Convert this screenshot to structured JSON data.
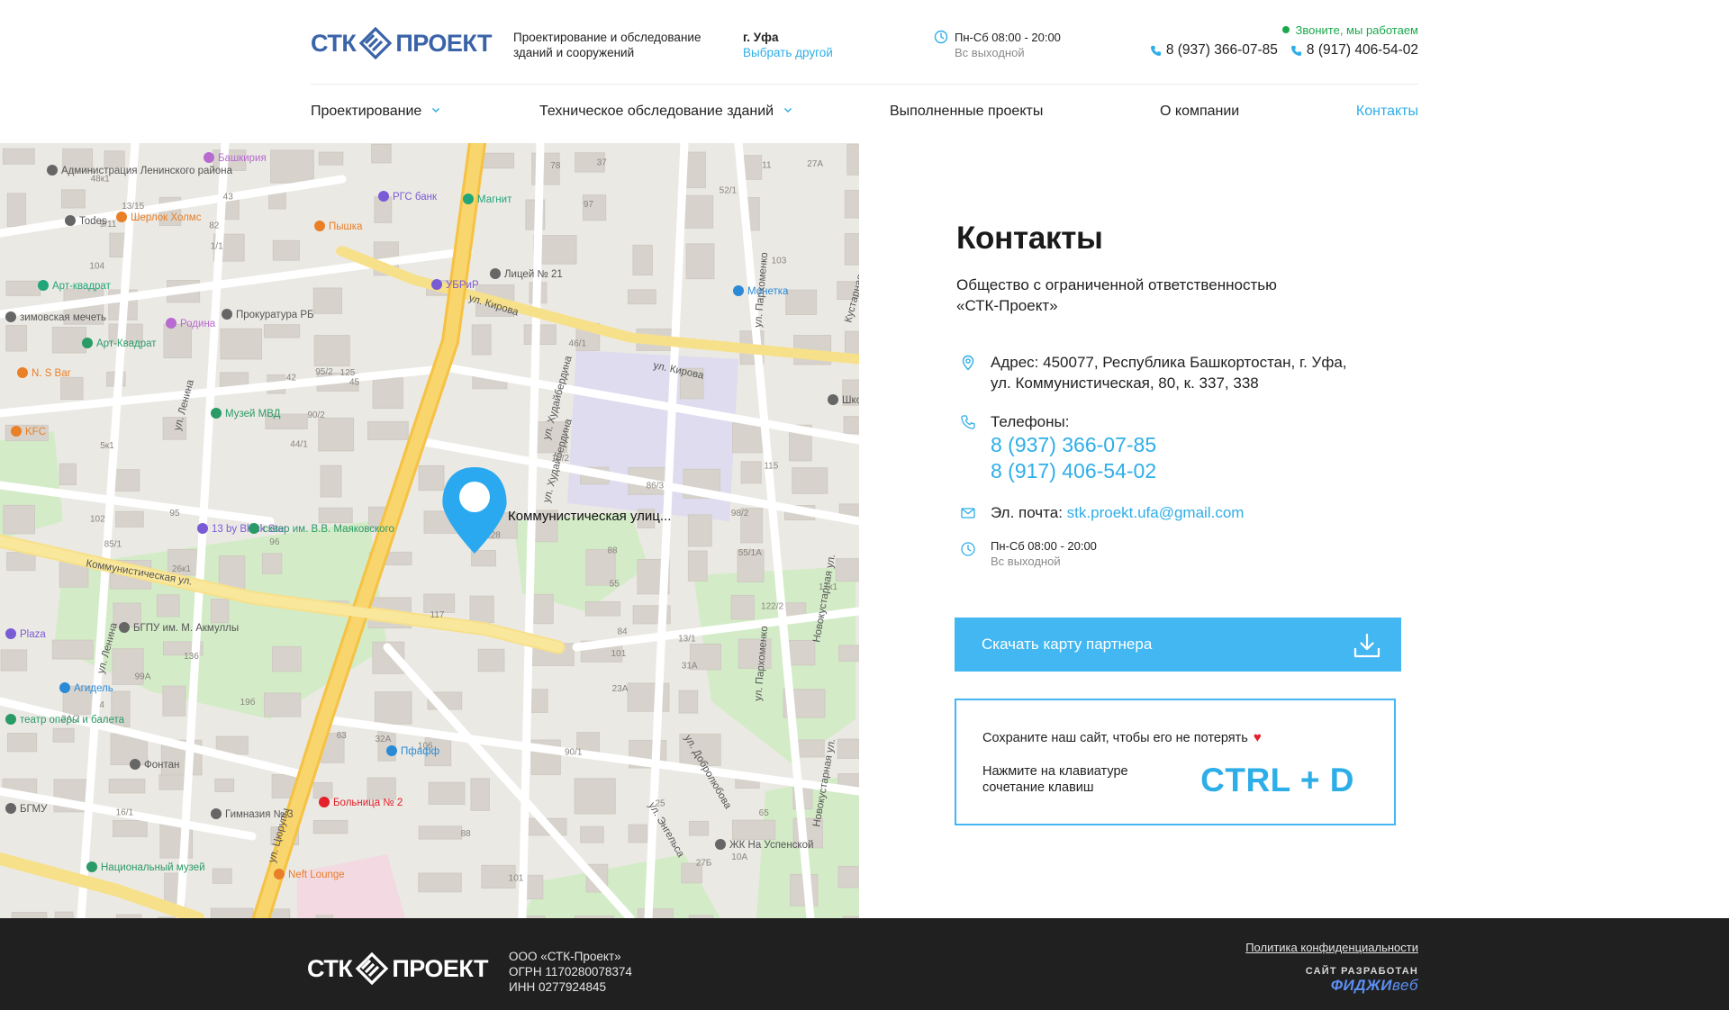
{
  "header": {
    "logo_left": "СТК",
    "logo_right": "ПРОЕКТ",
    "tagline_line1": "Проектирование и обследование",
    "tagline_line2": "зданий и сооружений",
    "city_label": "г. Уфа",
    "city_change": "Выбрать другой",
    "hours": "Пн-Сб 08:00 - 20:00",
    "hours_sub": "Вс выходной",
    "call_status": "Звоните, мы работаем",
    "phone1": "8 (937) 366-07-85",
    "phone2": "8 (917) 406-54-02",
    "accent_color": "#2eaee8"
  },
  "nav": {
    "items": [
      {
        "label": "Проектирование",
        "has_dropdown": true
      },
      {
        "label": "Техническое обследование зданий",
        "has_dropdown": true
      },
      {
        "label": "Выполненные проекты",
        "has_dropdown": false
      },
      {
        "label": "О компании",
        "has_dropdown": false
      },
      {
        "label": "Контакты",
        "has_dropdown": false,
        "active": true
      }
    ]
  },
  "map": {
    "marker_label": "Коммунистическая улиц...",
    "streets": [
      "ул. Кирова",
      "ул. Кирова",
      "Коммунистическая ул.",
      "ул. Ленина",
      "ул. Ленина",
      "ул. Ленина",
      "ул. Цюрупы",
      "ул. Худайбердина",
      "ул. Худайбердина",
      "ул. Пархоменко",
      "ул. Пархоменко",
      "ул. Добролюбова",
      "ул. Энгельса",
      "Коммунистическая ул.",
      "Новокустарная ул.",
      "Новокустарная ул.",
      "Кустарная ул."
    ],
    "places": [
      "Башкирия",
      "Администрация Ленинского района",
      "Todes",
      "Шерлок Холмс",
      "Пышка",
      "РГС банк",
      "Магнит",
      "Монетка",
      "УБРиР",
      "Лицей № 21",
      "Арт-квадрат",
      "Арт-Квадрат",
      "Прокуратура РБ",
      "Родина",
      "N. S Bar",
      "Музей МВД",
      "KFC",
      "Школа №",
      "13 by Black Star",
      "сквер им. В.В. Маяковского",
      "БГПУ им. М. Акмуллы",
      "Агидель",
      "Фонтан",
      "Гимназия № 3",
      "Больница № 2",
      "Пфафф",
      "Национальный музей",
      "Neft Lounge",
      "ЖК На Успенской",
      "БГМУ",
      "зимовская мечеть",
      "театр оперы и балета",
      "Plaza"
    ],
    "house_numbers": [
      "55",
      "55/1A",
      "16/1",
      "43",
      "45",
      "25",
      "4",
      "97",
      "42",
      "101",
      "104",
      "102",
      "9/11",
      "65",
      "63",
      "115",
      "117",
      "128",
      "125",
      "136",
      "27A",
      "52/1",
      "44/1",
      "122/2",
      "78",
      "82",
      "84",
      "85/1",
      "1/1",
      "86/3",
      "88",
      "90/1",
      "90/2",
      "96",
      "98/2",
      "31A",
      "101",
      "95",
      "106",
      "99A",
      "103",
      "37",
      "10A",
      "32A",
      "13/1",
      "19б",
      "3A/2",
      "13/15",
      "10/2",
      "5к1",
      "17к1",
      "95/2",
      "11",
      "88",
      "23A",
      "27Б",
      "46/1",
      "48к1",
      "26к1"
    ]
  },
  "contacts": {
    "title": "Контакты",
    "company_line1": "Общество с ограниченной ответственностью",
    "company_line2": "«СТК-Проект»",
    "address_label": "Адрес:",
    "address_line1": "450077, Республика Башкортостан, г. Уфа,",
    "address_line2": "ул. Коммунистическая, 80, к. 337, 338",
    "phones_label": "Телефоны:",
    "phone1": "8 (937) 366-07-85",
    "phone2": "8 (917) 406-54-02",
    "email_label": "Эл. почта:",
    "email": "stk.proekt.ufa@gmail.com",
    "hours": "Пн-Сб 08:00 - 20:00",
    "hours_sub": "Вс выходной",
    "download_button": "Скачать карту партнера",
    "save_line1": "Сохраните наш сайт, чтобы его не потерять",
    "save_line2": "Нажмите на клавиатуре сочетание клавиш",
    "shortcut": "CTRL + D"
  },
  "footer": {
    "logo_left": "СТК",
    "logo_right": "ПРОЕКТ",
    "company": "ООО «СТК-Проект»",
    "ogrn": "ОГРН 1170280078374",
    "inn": "ИНН 0277924845",
    "privacy": "Политика конфиденциальности",
    "dev_label": "САЙТ РАЗРАБОТАН",
    "dev_brand_bold": "ФИДЖИ",
    "dev_brand_light": "веб"
  }
}
